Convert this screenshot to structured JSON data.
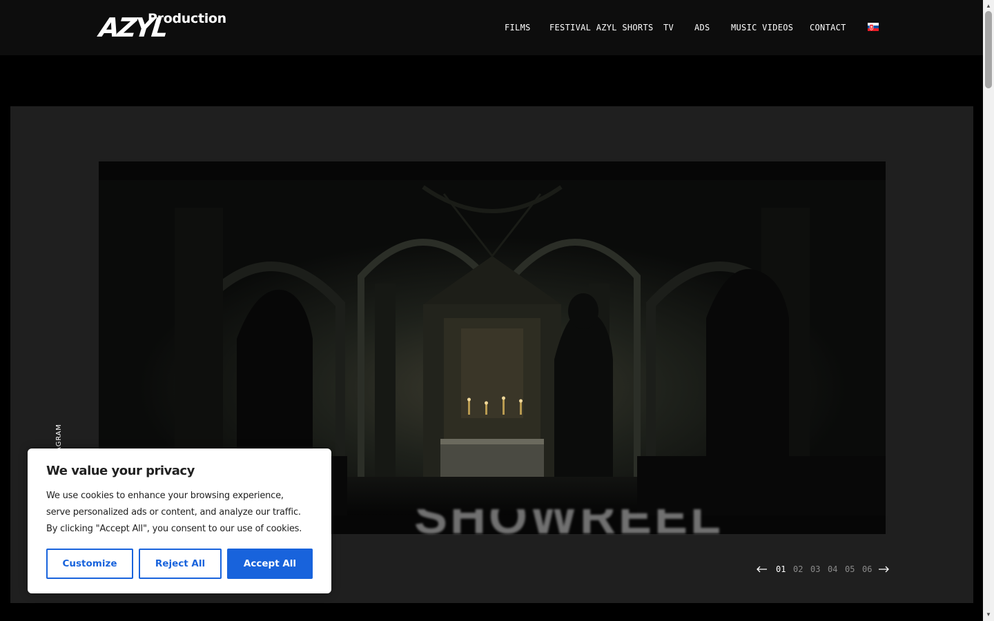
{
  "header": {
    "logo_mark": "AZYL",
    "logo_word": "Production",
    "nav": [
      {
        "label": "FILMS"
      },
      {
        "label": "FESTIVAL AZYL SHORTS"
      },
      {
        "label": "TV"
      },
      {
        "label": "ADS"
      },
      {
        "label": "MUSIC VIDEOS"
      },
      {
        "label": "CONTACT"
      }
    ],
    "language_flag": "slovak-flag-icon"
  },
  "hero": {
    "title_partial": "SHOWREEL",
    "slide_image": "church-interior-altar"
  },
  "social": {
    "label": "INSTAGRAM",
    "icon": "instagram-icon"
  },
  "pager": {
    "pages": [
      "01",
      "02",
      "03",
      "04",
      "05",
      "06"
    ],
    "active": "01",
    "prev_icon": "arrow-left-icon",
    "next_icon": "arrow-right-icon"
  },
  "cookie": {
    "title": "We value your privacy",
    "text": "We use cookies to enhance your browsing experience, serve personalized ads or content, and analyze our traffic. By clicking \"Accept All\", you consent to our use of cookies.",
    "customize": "Customize",
    "reject": "Reject All",
    "accept": "Accept All",
    "accent": "#1863dc"
  }
}
